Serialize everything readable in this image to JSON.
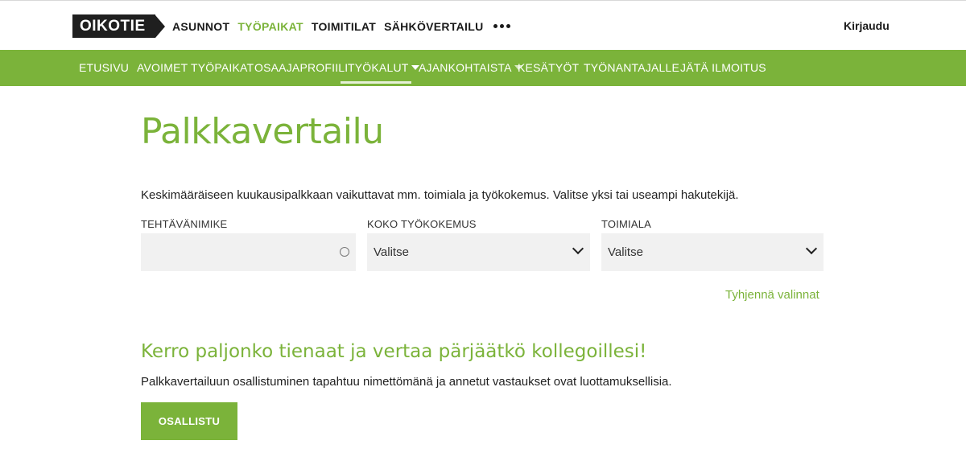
{
  "header": {
    "logo_text": "OIKOTIE",
    "nav": [
      {
        "label": "ASUNNOT",
        "active": false
      },
      {
        "label": "TYÖPAIKAT",
        "active": true
      },
      {
        "label": "TOIMITILAT",
        "active": false
      },
      {
        "label": "SÄHKÖVERTAILU",
        "active": false
      }
    ],
    "more_icon": "more-dots-icon",
    "login_label": "Kirjaudu"
  },
  "subnav": {
    "items": [
      {
        "label": "ETUSIVU"
      },
      {
        "label": "AVOIMET TYÖPAIKAT"
      },
      {
        "label": "OSAAJAPROFIILI"
      },
      {
        "label": "TYÖKALUT",
        "active": true,
        "dropdown": true
      },
      {
        "label": "AJANKOHTAISTA",
        "dropdown": true
      },
      {
        "label": "KESÄTYÖT"
      },
      {
        "label": "TYÖNANTAJALLE"
      },
      {
        "label": "JÄTÄ ILMOITUS"
      }
    ]
  },
  "main": {
    "title": "Palkkavertailu",
    "intro": "Keskimääräiseen kuukausipalkkaan vaikuttavat mm. toimiala ja työkokemus. Valitse yksi tai useampi hakutekijä.",
    "fields": {
      "job_title": {
        "label": "TEHTÄVÄNIMIKE",
        "value": ""
      },
      "experience": {
        "label": "KOKO TYÖKOKEMUS",
        "value": "Valitse"
      },
      "industry": {
        "label": "TOIMIALA",
        "value": "Valitse"
      }
    },
    "clear_label": "Tyhjennä valinnat",
    "survey_heading": "Kerro paljonko tienaat ja vertaa pärjäätkö kollegoillesi!",
    "survey_text": "Palkkavertailuun osallistuminen tapahtuu nimettömänä ja annetut vastaukset ovat luottamuksellisia.",
    "participate_label": "OSALLISTU"
  },
  "colors": {
    "brand_green": "#7bb33a",
    "logo_bg": "#1f1f1f",
    "field_bg": "#f1f1f1"
  }
}
